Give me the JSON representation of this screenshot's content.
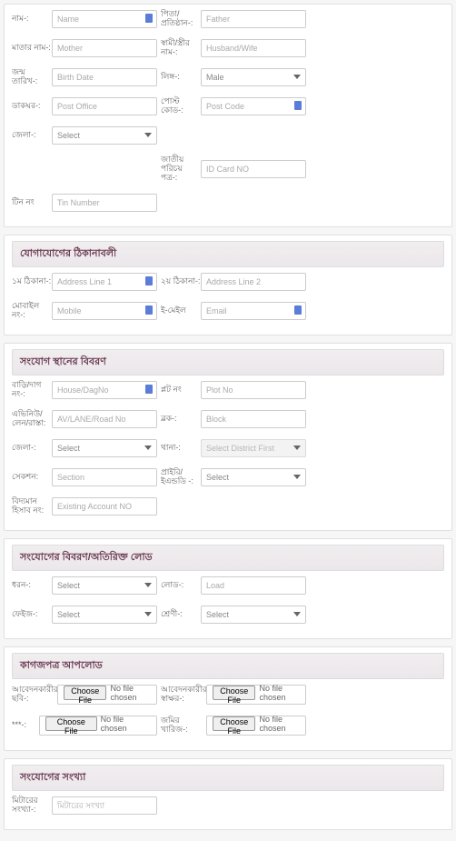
{
  "sections": {
    "s2_title": "যোগাযোগের ঠিকানাবলী",
    "s3_title": "সংযোগ স্থানের বিবরণ",
    "s4_title": "সংযোগের বিবরণ/অতিরিক্ত লোড",
    "s5_title": "কাগজপত্র আপলোড",
    "s6_title": "সংযোগের সংখ্যা"
  },
  "labels": {
    "name": "নাম-:",
    "father": "পিতা/প্রতিষ্ঠান-:",
    "mother": "মাতার নাম-:",
    "spouse": "স্বামী/স্ত্রীর নাম-:",
    "birthdate": "জন্ম তারিখ-:",
    "gender": "লিঙ্গ-:",
    "postoffice": "ডাকঘর-:",
    "postcode": "পোস্ট কোড-:",
    "district": "জেলা-:",
    "idcard": "জাতীয় পরিচয় পত্র-:",
    "tin": "টিন নং",
    "addr1": "১ম ঠিকানা-:",
    "addr2": "২য় ঠিকানা-:",
    "mobile": "মোবাইল নং-:",
    "email": "ই-মেইল",
    "house": "বাড়ি/দাগ নং-:",
    "plot": "প্লট নং",
    "avenue": "এভিনিউ/লেন/রাস্তা:",
    "block": "ব্লক-:",
    "district2": "জেলা-:",
    "thana": "থানা-:",
    "section": "সেকশন:",
    "supplyarea": "প্রাইরি/ইএন্ডডি -:",
    "existacc": "বিদ্যমান হিসাব নং:",
    "type": "ধরন-:",
    "load": "লোড-:",
    "phase": "ফেইজ-:",
    "class": "শ্রেণী-:",
    "applicant_photo": "আবেদনকারীর ছবি-:",
    "applicant_sign": "আবেদনকারীর স্বাক্ষর-:",
    "other": "***-:",
    "land_doc": "জমির খারিজ-:",
    "meter_count": "মিটারের সংখ্যা-:"
  },
  "placeholders": {
    "name": "Name",
    "father": "Father",
    "mother": "Mother",
    "spouse": "Husband/Wife",
    "birthdate": "Birth Date",
    "postoffice": "Post Office",
    "postcode": "Post Code",
    "idcard": "ID Card NO",
    "tin": "Tin Number",
    "addr1": "Address Line 1",
    "addr2": "Address Line 2",
    "mobile": "Mobile",
    "email": "Email",
    "house": "House/DagNo",
    "plot": "Plot No",
    "avenue": "AV/LANE/Road No",
    "block": "Block",
    "section": "Section",
    "existacc": "Existing Account NO",
    "load": "Load",
    "meter_count": "মিটারের সংখ্যা"
  },
  "selects": {
    "gender": "Male",
    "district": "Select",
    "district2": "Select",
    "thana": "Select District First",
    "supplyarea": "Select",
    "type": "Select",
    "phase": "Select",
    "class": "Select"
  },
  "file": {
    "choose": "Choose File",
    "nofile": "No file chosen"
  }
}
